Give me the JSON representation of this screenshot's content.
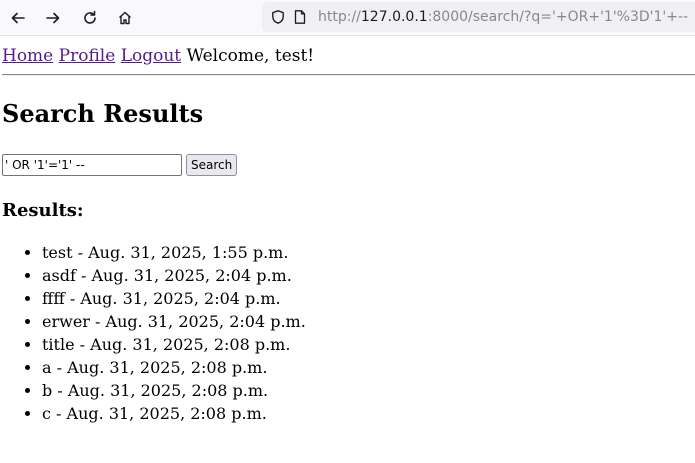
{
  "browser": {
    "url_prefix": "http://",
    "url_host": "127.0.0.1",
    "url_rest": ":8000/search/?q='+OR+'1'%3D'1'+--"
  },
  "nav": {
    "home": "Home",
    "profile": "Profile",
    "logout": "Logout",
    "welcome": "Welcome, test!"
  },
  "page_title": "Search Results",
  "search": {
    "value": "' OR '1'='1' --",
    "button_label": "Search"
  },
  "results_heading": "Results:",
  "results": [
    "test - Aug. 31, 2025, 1:55 p.m.",
    "asdf - Aug. 31, 2025, 2:04 p.m.",
    "ffff - Aug. 31, 2025, 2:04 p.m.",
    "erwer - Aug. 31, 2025, 2:04 p.m.",
    "title - Aug. 31, 2025, 2:08 p.m.",
    "a - Aug. 31, 2025, 2:08 p.m.",
    "b - Aug. 31, 2025, 2:08 p.m.",
    "c - Aug. 31, 2025, 2:08 p.m."
  ]
}
